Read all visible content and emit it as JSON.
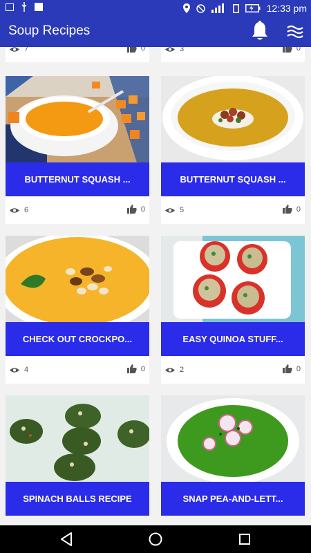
{
  "status_bar": {
    "time": "12:33 pm"
  },
  "app_bar": {
    "title": "Soup Recipes",
    "icons": [
      "bell-icon",
      "menu-waves-icon"
    ]
  },
  "top_stats": [
    {
      "views": "7",
      "likes": "0"
    },
    {
      "views": "3",
      "likes": "0"
    }
  ],
  "cards": [
    {
      "title": "BUTTERNUT SQUASH ...",
      "views": "6",
      "likes": "0"
    },
    {
      "title": "BUTTERNUT SQUASH ...",
      "views": "5",
      "likes": "0"
    },
    {
      "title": "CHECK OUT CROCKPO...",
      "views": "4",
      "likes": "0"
    },
    {
      "title": "EASY QUINOA STUFF...",
      "views": "2",
      "likes": "0"
    },
    {
      "title": "SPINACH BALLS RECIPE"
    },
    {
      "title": "SNAP PEA-AND-LETT..."
    }
  ],
  "colors": {
    "primary": "#2a3ab8",
    "banner": "#2b2bea"
  }
}
